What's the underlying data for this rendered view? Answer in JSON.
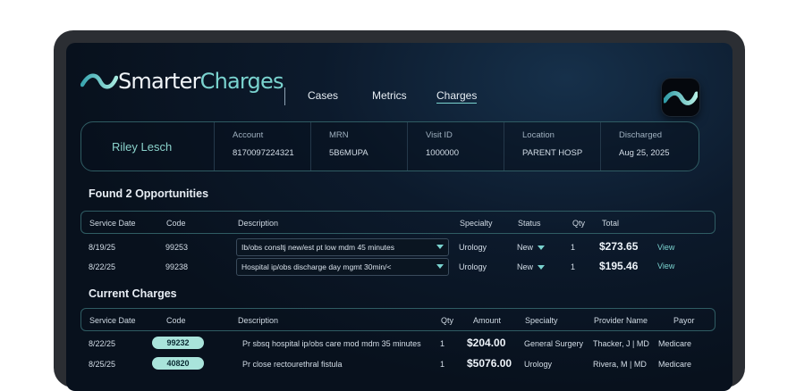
{
  "app": {
    "logo_primary": "Smarter",
    "logo_accent": "Charges",
    "nav": [
      "Cases",
      "Metrics",
      "Charges"
    ],
    "active_nav": "Charges",
    "accent_color": "#7ad3cf"
  },
  "patient": {
    "name": "Riley Lesch",
    "fields": [
      {
        "label": "Account",
        "value": "8170097224321"
      },
      {
        "label": "MRN",
        "value": "5B6MUPA"
      },
      {
        "label": "Visit ID",
        "value": "1000000"
      },
      {
        "label": "Location",
        "value": "PARENT HOSP"
      },
      {
        "label": "Discharged",
        "value": "Aug 25, 2025"
      }
    ]
  },
  "opportunities": {
    "title": "Found 2 Opportunities",
    "headers": [
      "Service Date",
      "Code",
      "Description",
      "Specialty",
      "Status",
      "Qty",
      "Total"
    ],
    "rows": [
      {
        "date": "8/19/25",
        "code": "99253",
        "description": "Ib/obs consltj new/est pt low mdm 45 minutes",
        "specialty": "Urology",
        "status": "New",
        "qty": "1",
        "total": "$273.65",
        "action": "View"
      },
      {
        "date": "8/22/25",
        "code": "99238",
        "description": "Hospital ip/obs discharge day mgmt 30min/<",
        "specialty": "Urology",
        "status": "New",
        "qty": "1",
        "total": "$195.46",
        "action": "View"
      }
    ]
  },
  "current": {
    "title": "Current Charges",
    "headers": [
      "Service Date",
      "Code",
      "Description",
      "Qty",
      "Amount",
      "Specialty",
      "Provider Name",
      "Payor"
    ],
    "rows": [
      {
        "date": "8/22/25",
        "code": "99232",
        "description": "Pr sbsq hospital ip/obs care mod mdm 35 minutes",
        "qty": "1",
        "amount": "$204.00",
        "specialty": "General Surgery",
        "provider": "Thacker, J | MD",
        "payor": "Medicare"
      },
      {
        "date": "8/25/25",
        "code": "40820",
        "description": "Pr close rectourethral fistula",
        "qty": "1",
        "amount": "$5076.00",
        "specialty": "Urology",
        "provider": "Rivera, M | MD",
        "payor": "Medicare"
      }
    ]
  }
}
